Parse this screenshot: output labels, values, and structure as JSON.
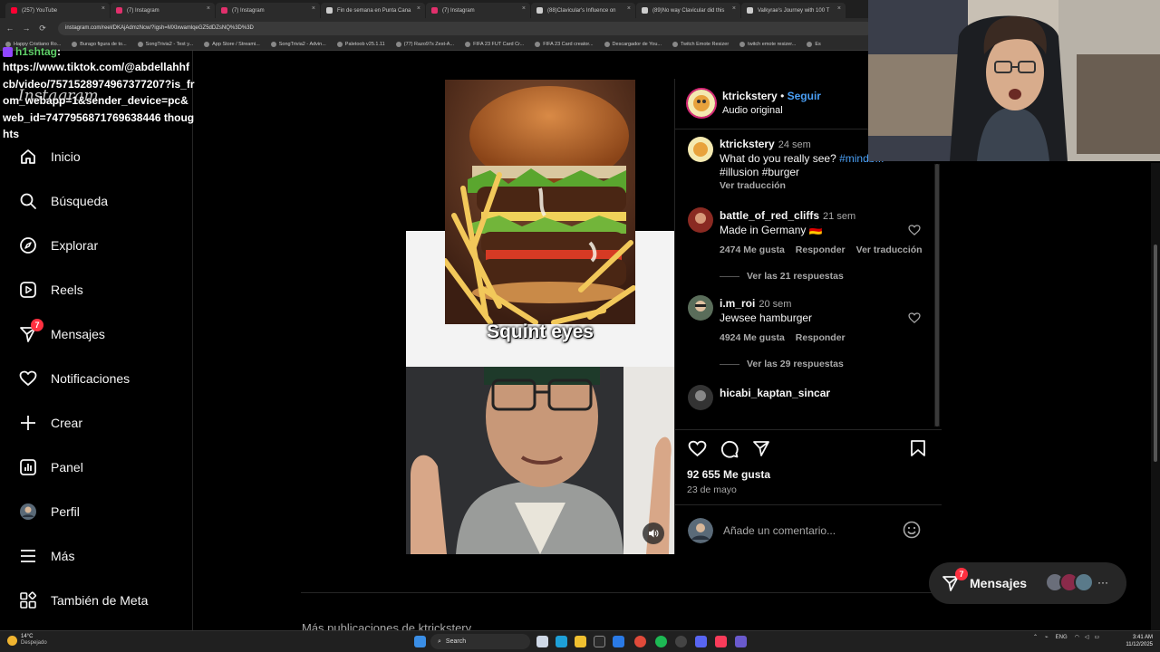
{
  "browser": {
    "tabs": [
      {
        "title": "(257) YouTube",
        "color": "#ff0033"
      },
      {
        "title": "(7) Instagram",
        "color": "#e1306c"
      },
      {
        "title": "(7) Instagram",
        "color": "#e1306c"
      },
      {
        "title": "Fin de semana en Punta Cana",
        "color": "#cccccc"
      },
      {
        "title": "(7) Instagram",
        "color": "#e1306c"
      },
      {
        "title": "(88)Clavicular's Influence on",
        "color": "#cccccc"
      },
      {
        "title": "(89)No way Clavicular did this",
        "color": "#cccccc"
      },
      {
        "title": "Valkyrae's Journey with 100 T",
        "color": "#cccccc"
      }
    ],
    "url": "instagram.com/reel/DKAjAdmzNcw/?igsh=MXlxwamlqeGZ5dDZsNQ%3D%3D",
    "bookmarks": [
      "Happy Cristiano Ro...",
      "Burago figura de to...",
      "SongTrivia2 - Test y...",
      "App Store / Streami...",
      "SongTrivia2 - Advin...",
      "Paletoob v25.1.11",
      "(77) Razo97s Zest-A...",
      "FIFA 23 FUT Card Cr...",
      "FIFA 23 Card creator...",
      "Descargador de You...",
      "Twitch Emote Resizer",
      "twitch emote resizer...",
      "Es"
    ]
  },
  "overlay": {
    "tag": "h1shtag",
    "tag_suffix": ":",
    "url_text": "https://www.tiktok.com/@abdellahhfcb/video/7571528974967377207?is_from_webapp=1&sender_device=pc&web_id=7477956871769638446 thoughts"
  },
  "sidebar": {
    "logo": "Instagram",
    "items": [
      {
        "label": "Inicio",
        "icon": "home-icon"
      },
      {
        "label": "Búsqueda",
        "icon": "search-icon"
      },
      {
        "label": "Explorar",
        "icon": "compass-icon"
      },
      {
        "label": "Reels",
        "icon": "reels-icon"
      },
      {
        "label": "Mensajes",
        "icon": "messenger-icon",
        "badge": "7"
      },
      {
        "label": "Notificaciones",
        "icon": "heart-icon"
      },
      {
        "label": "Crear",
        "icon": "plus-icon"
      },
      {
        "label": "Panel",
        "icon": "dashboard-icon"
      },
      {
        "label": "Perfil",
        "icon": "avatar"
      },
      {
        "label": "Más",
        "icon": "menu-icon"
      },
      {
        "label": "También de Meta",
        "icon": "meta-icon"
      }
    ]
  },
  "reel": {
    "caption": "Squint eyes"
  },
  "post": {
    "author": "ktrickstery",
    "separator": "•",
    "follow": "Seguir",
    "audio": "Audio original",
    "comments": [
      {
        "user": "ktrickstery",
        "time": "24 sem",
        "text": "What do you really see?",
        "tags_line1": "#mindb...",
        "tags_line2": "#illusion #burger",
        "translate": "Ver traducción"
      },
      {
        "user": "battle_of_red_cliffs",
        "time": "21 sem",
        "text": "Made in Germany 🇩🇪",
        "likes": "2474 Me gusta",
        "reply": "Responder",
        "translate": "Ver traducción",
        "replies": "Ver las 21 respuestas"
      },
      {
        "user": "i.m_roi",
        "time": "20 sem",
        "text": "Jewsee hamburger",
        "likes": "4924 Me gusta",
        "reply": "Responder",
        "replies": "Ver las 29 respuestas"
      },
      {
        "user": "hicabi_kaptan_sincar"
      }
    ],
    "likes": "92 655 Me gusta",
    "date": "23 de mayo",
    "add_comment_placeholder": "Añade un comentario..."
  },
  "messages_pill": {
    "label": "Mensajes",
    "badge": "7"
  },
  "below": {
    "more_from": "Más publicaciones de ktrickstery"
  },
  "taskbar": {
    "temp": "14°C",
    "weather": "Despejado",
    "search": "Search",
    "lang": "ENG",
    "time": "3:41 AM",
    "date": "11/12/2025"
  },
  "colors": {
    "accent_link": "#4a9ff5",
    "badge": "#ff3040"
  }
}
